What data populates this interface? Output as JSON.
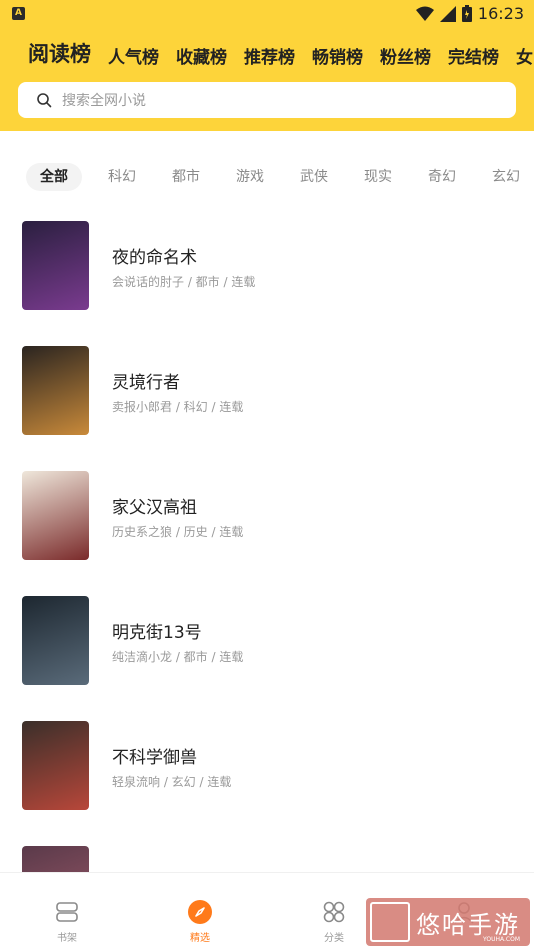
{
  "status_bar": {
    "badge": "A",
    "time": "16:23"
  },
  "tabs": [
    {
      "label": "阅读榜",
      "active": true
    },
    {
      "label": "人气榜"
    },
    {
      "label": "收藏榜"
    },
    {
      "label": "推荐榜"
    },
    {
      "label": "畅销榜"
    },
    {
      "label": "粉丝榜"
    },
    {
      "label": "完结榜"
    },
    {
      "label": "女"
    }
  ],
  "search": {
    "placeholder": "搜索全网小说"
  },
  "categories": [
    "全部",
    "科幻",
    "都市",
    "游戏",
    "武侠",
    "现实",
    "奇幻",
    "玄幻"
  ],
  "books": [
    {
      "title": "夜的命名术",
      "meta": "会说话的肘子 / 都市 / 连载",
      "cover_colors": [
        "#2a1f3f",
        "#7a3b8f"
      ]
    },
    {
      "title": "灵境行者",
      "meta": "卖报小郎君 / 科幻 / 连载",
      "cover_colors": [
        "#2a2420",
        "#c98a3a"
      ]
    },
    {
      "title": "家父汉高祖",
      "meta": "历史系之狼 / 历史 / 连载",
      "cover_colors": [
        "#efe7db",
        "#7a2a2a"
      ]
    },
    {
      "title": "明克街13号",
      "meta": "纯洁滴小龙 / 都市 / 连载",
      "cover_colors": [
        "#1d2730",
        "#5a6b7a"
      ]
    },
    {
      "title": "不科学御兽",
      "meta": "轻泉流响 / 玄幻 / 连载",
      "cover_colors": [
        "#3a2f2a",
        "#b8473a"
      ]
    },
    {
      "title": "",
      "meta": "",
      "cover_colors": [
        "#5a3a4a",
        "#a05a6a"
      ]
    }
  ],
  "bottom_nav": [
    {
      "label": "书架",
      "icon": "bookshelf-icon"
    },
    {
      "label": "精选",
      "icon": "compass-icon",
      "active": true
    },
    {
      "label": "分类",
      "icon": "category-icon"
    },
    {
      "label": "",
      "icon": "profile-icon"
    }
  ],
  "watermark": {
    "text": "悠哈手游",
    "sub": "YOUHA.COM"
  },
  "colors": {
    "accent": "#fdd43a",
    "active": "#ff7a1a"
  }
}
